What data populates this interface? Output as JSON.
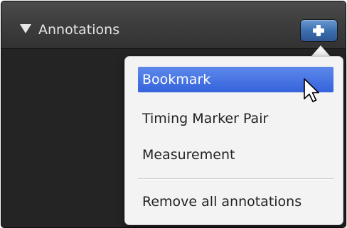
{
  "panel": {
    "title": "Annotations",
    "collapse_icon": "triangle-down-icon",
    "add_icon": "plus-icon",
    "colors": {
      "header": "#3e3e3e",
      "body": "#242424",
      "add_button": "#3d6fb0"
    }
  },
  "menu": {
    "items": [
      {
        "label": "Bookmark",
        "selected": true
      },
      {
        "label": "Timing Marker Pair",
        "selected": false
      },
      {
        "label": "Measurement",
        "selected": false
      }
    ],
    "footer_item": {
      "label": "Remove all annotations"
    },
    "colors": {
      "background": "#f3f3f3",
      "highlight": "#3f6fe0",
      "text": "#222222"
    }
  },
  "cursor_icon": "arrow-cursor-icon"
}
